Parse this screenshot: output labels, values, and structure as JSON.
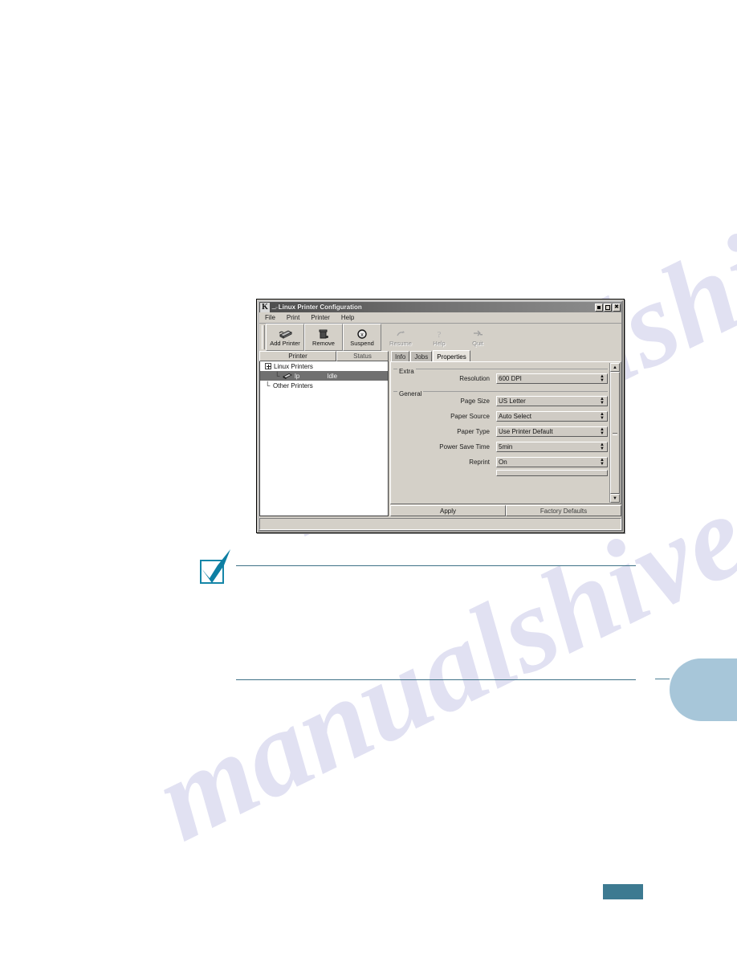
{
  "window": {
    "icon": "k-logo-icon",
    "title": "Linux Printer Configuration",
    "buttons": {
      "minimize": "minimize-button",
      "maximize": "maximize-button",
      "close": "✖"
    }
  },
  "menubar": {
    "items": [
      {
        "label": "File"
      },
      {
        "label": "Print"
      },
      {
        "label": "Printer"
      },
      {
        "label": "Help"
      }
    ]
  },
  "toolbar": {
    "buttons": [
      {
        "label": "Add Printer",
        "icon": "printer-icon",
        "enabled": true
      },
      {
        "label": "Remove",
        "icon": "trash-icon",
        "enabled": true
      },
      {
        "label": "Suspend",
        "icon": "stop-icon",
        "enabled": true
      },
      {
        "label": "Resume",
        "icon": "resume-icon",
        "enabled": false
      },
      {
        "label": "Help",
        "icon": "help-icon",
        "enabled": false
      },
      {
        "label": "Quit",
        "icon": "exit-icon",
        "enabled": false
      }
    ]
  },
  "printer_list": {
    "columns": [
      {
        "label": "Printer"
      },
      {
        "label": "Status"
      }
    ],
    "rows": [
      {
        "label": "Linux Printers",
        "status": "",
        "level": 0,
        "selected": false,
        "expander": "expander-minus-icon"
      },
      {
        "label": "lp",
        "status": "Idle",
        "level": 1,
        "selected": true,
        "icon": "printer-small-icon"
      },
      {
        "label": "Other Printers",
        "status": "",
        "level": 0,
        "selected": false,
        "expander": "none"
      }
    ]
  },
  "tabs": [
    {
      "label": "Info",
      "active": false
    },
    {
      "label": "Jobs",
      "active": false
    },
    {
      "label": "Properties",
      "active": true
    }
  ],
  "properties": {
    "groups": [
      {
        "legend": "Extra",
        "rows": [
          {
            "label": "Resolution",
            "value": "600 DPI"
          }
        ]
      },
      {
        "legend": "General",
        "rows": [
          {
            "label": "Page Size",
            "value": "US Letter"
          },
          {
            "label": "Paper Source",
            "value": "Auto Select"
          },
          {
            "label": "Paper Type",
            "value": "Use Printer Default"
          },
          {
            "label": "Power Save Time",
            "value": "5min"
          },
          {
            "label": "Reprint",
            "value": "On"
          }
        ]
      }
    ],
    "scrollbar": {
      "up": "▲",
      "down": "▼"
    }
  },
  "actions": {
    "apply": "Apply",
    "factory_defaults": "Factory Defaults"
  },
  "page_decor": {
    "watermark_text": "manualshive.com",
    "note_icon": "checkmark-note-icon",
    "colors": {
      "side_tab": "#a7c6d9",
      "page_number_block": "#3d7a91",
      "rule": "#3e7186",
      "check": "#1586a8"
    }
  }
}
